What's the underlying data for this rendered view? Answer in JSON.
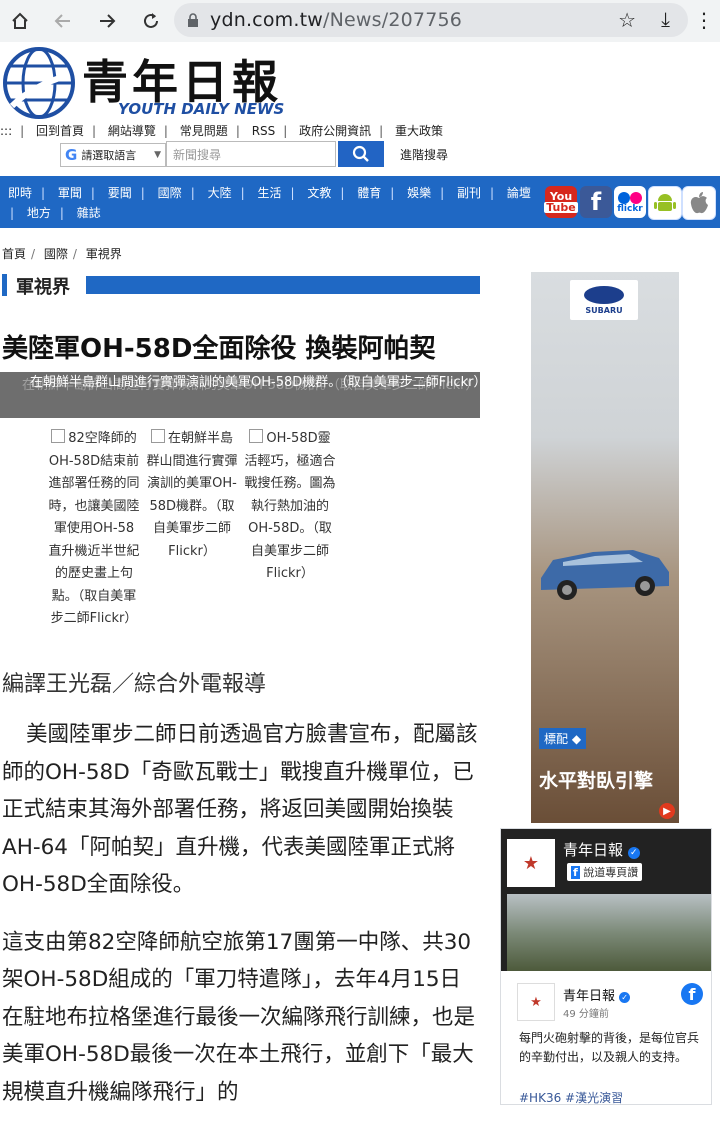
{
  "browser": {
    "url_domain": "ydn.com.tw",
    "url_path": "/News/207756"
  },
  "header": {
    "logo_cn": "青年日報",
    "logo_en": "YOUTH DAILY NEWS",
    "top_links": [
      ":::",
      "回到首頁",
      "網站導覽",
      "常見問題",
      "RSS",
      "政府公開資訊",
      "重大政策"
    ],
    "translate_label": "請選取語言",
    "search_placeholder": "新聞搜尋",
    "advanced_search": "進階搜尋"
  },
  "nav": {
    "row1": [
      "即時",
      "軍聞",
      "要聞",
      "國際",
      "大陸",
      "生活",
      "文教",
      "體育",
      "娛樂",
      "副刊",
      "論壇"
    ],
    "row2": [
      "地方",
      "雜誌"
    ],
    "social": [
      "YouTube",
      "Facebook",
      "Flickr",
      "Android",
      "Apple"
    ]
  },
  "breadcrumb": [
    "首頁",
    "國際",
    "軍視界"
  ],
  "section": "軍視界",
  "article": {
    "headline": "美陸軍OH-58D全面除役  換裝阿帕契",
    "overlay_caption": "在朝鮮半島群山間進行實彈演訓的美軍OH-58D機群。（取自美軍步二師Flickr）",
    "image_captions": [
      "82空降師的OH-58D結束前進部署任務的同時，也讓美國陸軍使用OH-58直升機近半世紀的歷史畫上句點。（取自美軍步二師Flickr）",
      "在朝鮮半島群山間進行實彈演訓的美軍OH-58D機群。（取自美軍步二師Flickr）",
      "OH-58D靈活輕巧，極適合戰搜任務。圖為執行熱加油的OH-58D。（取自美軍步二師Flickr）"
    ],
    "byline": "編譯王光磊／綜合外電報導",
    "paragraphs": [
      "美國陸軍步二師日前透過官方臉書宣布，配屬該師的OH-58D「奇歐瓦戰士」戰搜直升機單位，已正式結束其海外部署任務，將返回美國開始換裝AH-64「阿帕契」直升機，代表美國陸軍正式將OH-58D全面除役。",
      "這支由第82空降師航空旅第17團第一中隊、共30架OH-58D組成的「軍刀特遣隊」，去年4月15日在駐地布拉格堡進行最後一次編隊飛行訓練，也是美軍OH-58D最後一次在本土飛行，並創下「最大規模直升機編隊飛行」的"
    ]
  },
  "ad": {
    "brand": "SUBARU",
    "badge": "標配",
    "slogan": "水平對臥引擎"
  },
  "facebook": {
    "page_name": "青年日報",
    "follow_label": "說道專頁讚",
    "post_name": "青年日報",
    "post_time": "49 分鐘前",
    "post_text": "每門火砲射擊的背後，是每位官兵的辛勤付出，以及親人的支持。",
    "tags": "#HK36 #漢光演習"
  },
  "colors": {
    "nav_blue": "#1f68c4",
    "accent_blue": "#2264c4",
    "youtube_red": "#d6281d",
    "facebook_blue": "#3b5998"
  }
}
